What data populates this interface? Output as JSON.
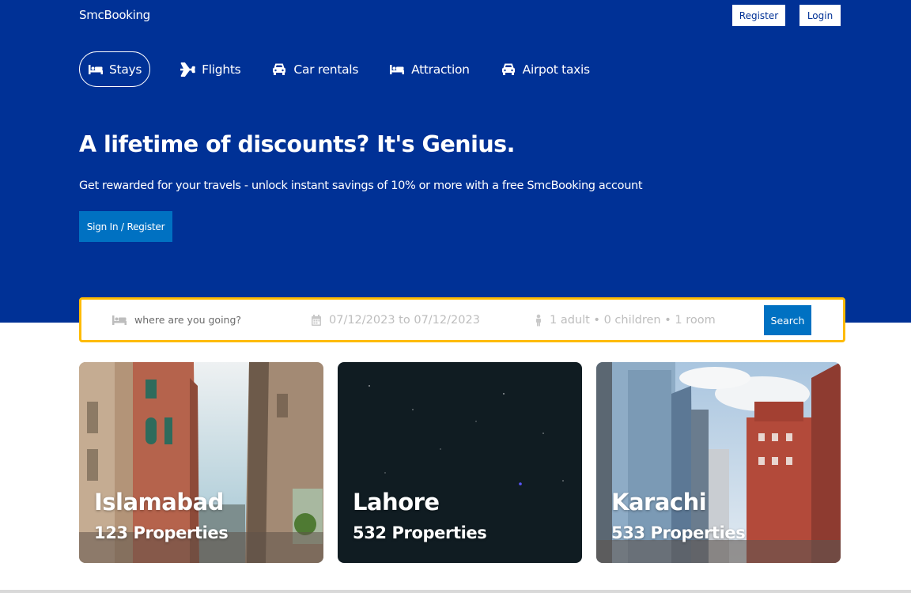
{
  "header": {
    "brand": "SmcBooking",
    "register_label": "Register",
    "login_label": "Login"
  },
  "nav": {
    "items": [
      {
        "label": "Stays",
        "icon": "bed-icon",
        "active": true
      },
      {
        "label": "Flights",
        "icon": "plane-icon"
      },
      {
        "label": "Car rentals",
        "icon": "car-icon"
      },
      {
        "label": "Attraction",
        "icon": "bed-icon"
      },
      {
        "label": "Airpot taxis",
        "icon": "car-icon"
      }
    ]
  },
  "hero": {
    "title": "A lifetime of discounts? It's Genius.",
    "subtitle": "Get rewarded for your travels - unlock instant savings of 10% or more with a free SmcBooking account",
    "cta_label": "Sign In / Register"
  },
  "search": {
    "destination_placeholder": "where are you going?",
    "dates": "07/12/2023 to 07/12/2023",
    "guests": "1 adult • 0 children • 1 room",
    "button_label": "Search"
  },
  "cities": [
    {
      "name": "Islamabad",
      "properties": "123 Properties"
    },
    {
      "name": "Lahore",
      "properties": "532 Properties"
    },
    {
      "name": "Karachi",
      "properties": "533 Properties"
    }
  ],
  "colors": {
    "hero_bg": "#003196",
    "primary_button": "#0071c2",
    "search_border": "#febb02"
  }
}
